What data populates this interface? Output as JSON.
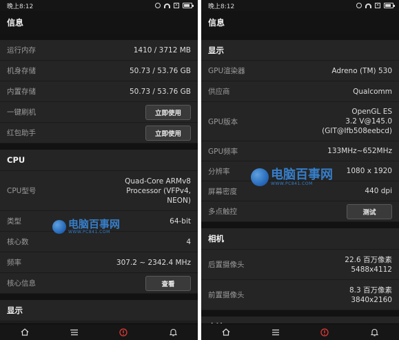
{
  "left": {
    "status_time": "晚上8:12",
    "title": "信息",
    "rows_top": [
      {
        "label": "运行内存",
        "value": "1410 / 3712 MB"
      },
      {
        "label": "机身存储",
        "value": "50.73 / 53.76 GB"
      },
      {
        "label": "内置存储",
        "value": "50.73 / 53.76 GB"
      }
    ],
    "flash": {
      "label": "一键刷机",
      "button": "立即使用"
    },
    "redpacket": {
      "label": "红包助手",
      "button": "立即使用"
    },
    "cpu_section": "CPU",
    "cpu_model": {
      "label": "CPU型号",
      "lines": [
        "Quad-Core ARMv8",
        "Processor (VFPv4,",
        "NEON)"
      ]
    },
    "cpu_type": {
      "label": "类型",
      "value": "64-bit"
    },
    "cpu_cores": {
      "label": "核心数",
      "value": "4"
    },
    "cpu_freq": {
      "label": "频率",
      "value": "307.2 ~ 2342.4 MHz"
    },
    "core_info": {
      "label": "核心信息",
      "button": "查看"
    },
    "display_section": "显示"
  },
  "right": {
    "status_time": "晚上8:12",
    "title": "信息",
    "display_section": "显示",
    "gpu_renderer": {
      "label": "GPU渲染器",
      "value": "Adreno (TM) 530"
    },
    "vendor": {
      "label": "供应商",
      "value": "Qualcomm"
    },
    "gpu_version": {
      "label": "GPU版本",
      "lines": [
        "OpenGL ES",
        "3.2 V@145.0",
        "(GIT@Ifb508eebcd)"
      ]
    },
    "gpu_freq": {
      "label": "GPU频率",
      "value": "133MHz~652MHz"
    },
    "resolution": {
      "label": "分辨率",
      "value": "1080 x 1920"
    },
    "density": {
      "label": "屏幕密度",
      "value": "440 dpi"
    },
    "multitouch": {
      "label": "多点触控",
      "button": "测试"
    },
    "camera_section": "相机",
    "rear_camera": {
      "label": "后置摄像头",
      "lines": [
        "22.6 百万像素",
        "5488x4112"
      ]
    },
    "front_camera": {
      "label": "前置摄像头",
      "lines": [
        "8.3 百万像素",
        "3840x2160"
      ]
    },
    "battery_section": "电池"
  },
  "watermark": {
    "name": "电脑百事网",
    "url": "WWW.PC841.COM"
  },
  "colors": {
    "alert": "#e53935",
    "watermark": "#3a8ee6"
  }
}
